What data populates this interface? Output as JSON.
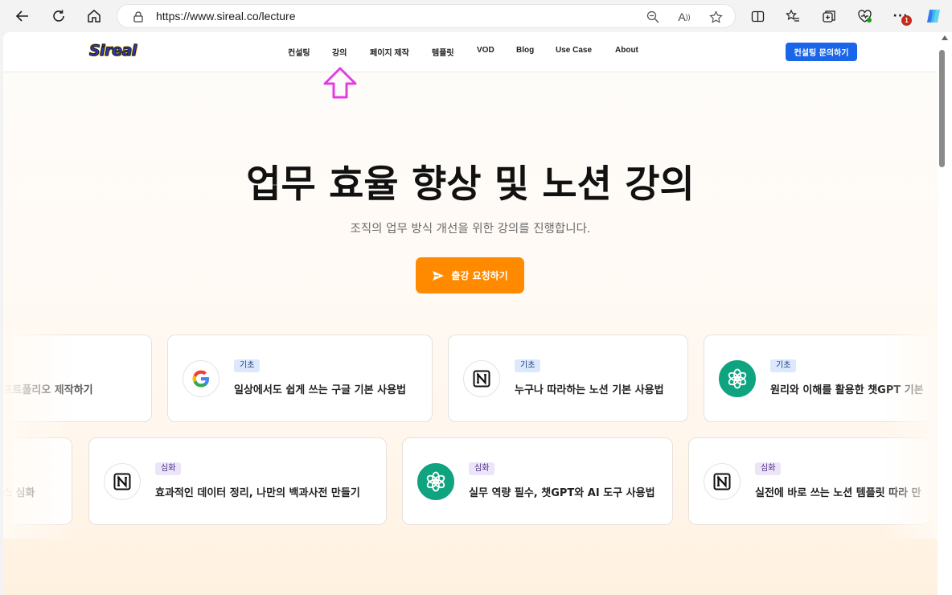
{
  "browser": {
    "url": "https://www.sireal.co/lecture",
    "notification_count": "1"
  },
  "site": {
    "logo_text": "Sireal",
    "nav": [
      "컨설팅",
      "강의",
      "페이지 제작",
      "템플릿",
      "VOD",
      "Blog",
      "Use Case",
      "About"
    ],
    "cta_label": "컨설팅 문의하기"
  },
  "hero": {
    "title": "업무 효율 향상 및 노션 강의",
    "subtitle": "조직의 업무 방식 개선을 위한 강의를 진행합니다.",
    "cta_label": "출강 요청하기"
  },
  "cards_row1": [
    {
      "tag": "",
      "title": "노션 포트폴리오 제작하기",
      "icon": "none"
    },
    {
      "tag": "기초",
      "title": "일상에서도 쉽게 쓰는 구글 기본 사용법",
      "icon": "google-icon"
    },
    {
      "tag": "기초",
      "title": "누구나 따라하는 노션 기본 사용법",
      "icon": "notion-icon"
    },
    {
      "tag": "기초",
      "title": "원리와 이해를 활용한 챗GPT 기본",
      "icon": "chatgpt-icon"
    }
  ],
  "cards_row2": [
    {
      "tag": "",
      "title": "이스 심화",
      "icon": "none"
    },
    {
      "tag": "심화",
      "title": "효과적인 데이터 정리, 나만의 백과사전 만들기",
      "icon": "notion-icon"
    },
    {
      "tag": "심화",
      "title": "실무 역량 필수, 챗GPT와 AI 도구 사용법",
      "icon": "chatgpt-icon"
    },
    {
      "tag": "심화",
      "title": "실전에 바로 쓰는 노션 템플릿 따라 만",
      "icon": "notion-icon"
    }
  ],
  "colors": {
    "accent_orange": "#ff8a00",
    "primary_blue": "#1a66e8",
    "arrow_magenta": "#e23ce6"
  }
}
